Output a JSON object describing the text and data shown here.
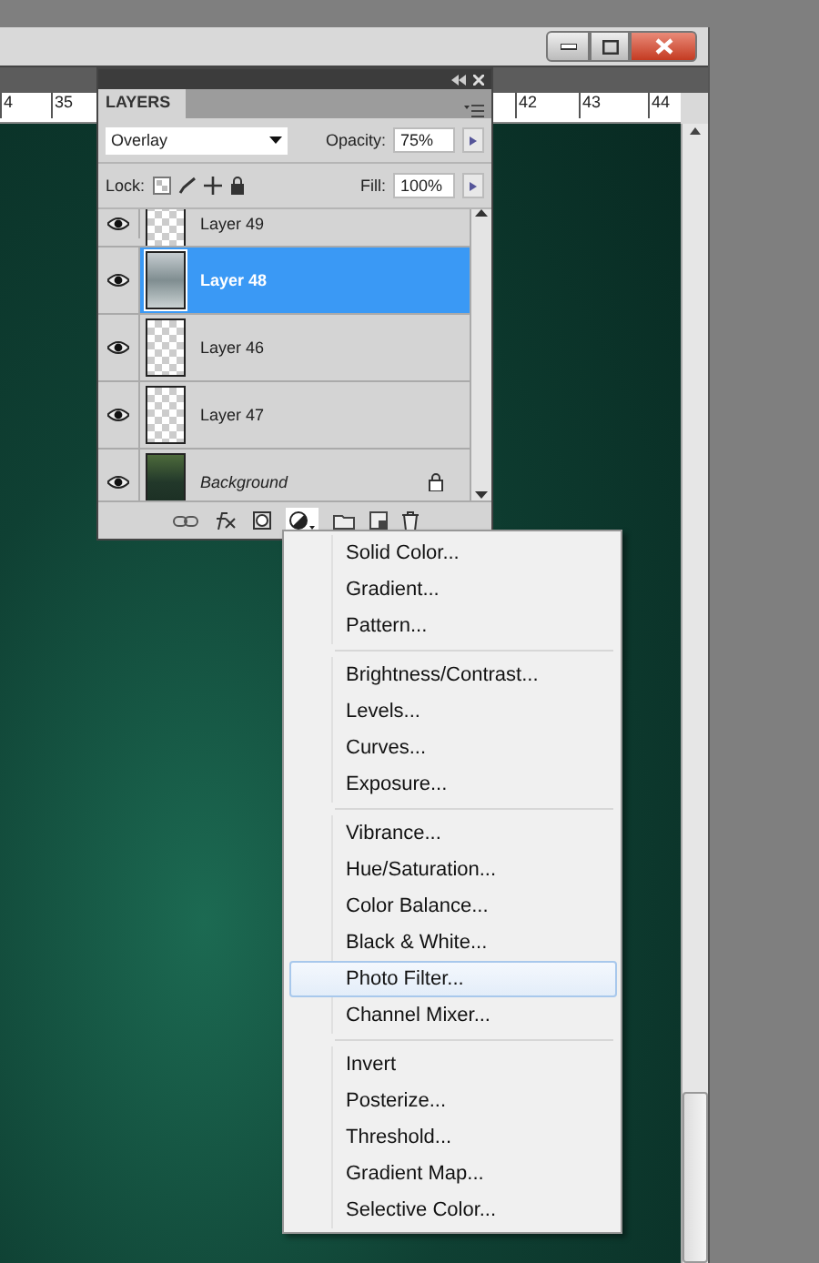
{
  "ruler": {
    "marks": [
      "4",
      "35",
      "42",
      "43",
      "44"
    ]
  },
  "layers_panel": {
    "tab": "LAYERS",
    "blend_mode": "Overlay",
    "opacity_label": "Opacity:",
    "opacity": "75%",
    "lock_label": "Lock:",
    "fill_label": "Fill:",
    "fill": "100%",
    "layers": [
      {
        "name": "Layer 49",
        "kind": "layer",
        "visible": true,
        "selected": false,
        "locked": false
      },
      {
        "name": "Layer 48",
        "kind": "layer",
        "visible": true,
        "selected": true,
        "locked": false
      },
      {
        "name": "Layer 46",
        "kind": "layer",
        "visible": true,
        "selected": false,
        "locked": false
      },
      {
        "name": "Layer 47",
        "kind": "layer",
        "visible": true,
        "selected": false,
        "locked": false
      },
      {
        "name": "Background",
        "kind": "background",
        "visible": true,
        "selected": false,
        "locked": true
      }
    ]
  },
  "adjustment_menu": {
    "groups": [
      [
        {
          "label": "Solid Color...",
          "selected": false
        },
        {
          "label": "Gradient...",
          "selected": false
        },
        {
          "label": "Pattern...",
          "selected": false
        }
      ],
      [
        {
          "label": "Brightness/Contrast...",
          "selected": false
        },
        {
          "label": "Levels...",
          "selected": false
        },
        {
          "label": "Curves...",
          "selected": false
        },
        {
          "label": "Exposure...",
          "selected": false
        }
      ],
      [
        {
          "label": "Vibrance...",
          "selected": false
        },
        {
          "label": "Hue/Saturation...",
          "selected": false
        },
        {
          "label": "Color Balance...",
          "selected": false
        },
        {
          "label": "Black & White...",
          "selected": false
        },
        {
          "label": "Photo Filter...",
          "selected": true
        },
        {
          "label": "Channel Mixer...",
          "selected": false
        }
      ],
      [
        {
          "label": "Invert",
          "selected": false
        },
        {
          "label": "Posterize...",
          "selected": false
        },
        {
          "label": "Threshold...",
          "selected": false
        },
        {
          "label": "Gradient Map...",
          "selected": false
        },
        {
          "label": "Selective Color...",
          "selected": false
        }
      ]
    ]
  }
}
